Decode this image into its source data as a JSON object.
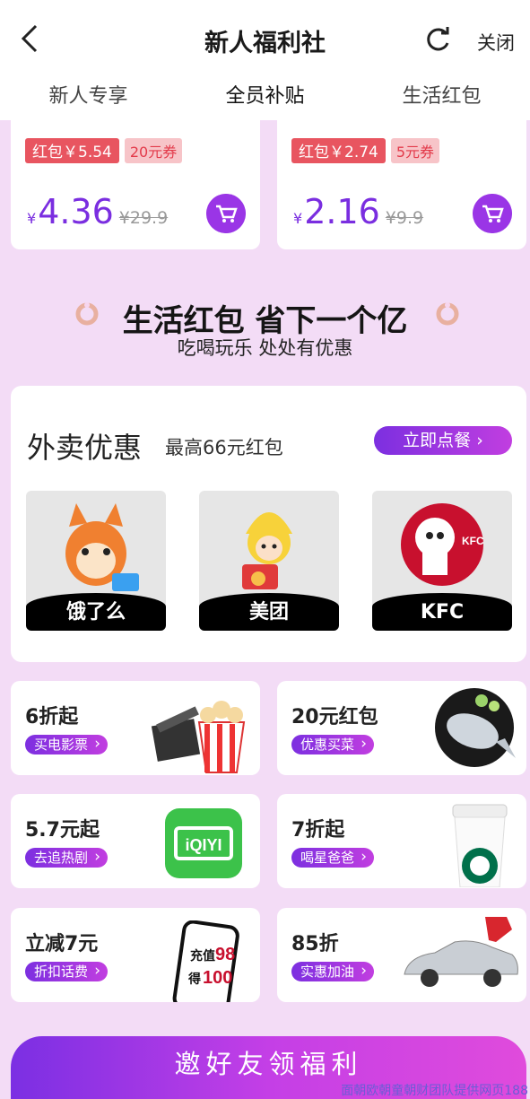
{
  "header": {
    "title": "新人福利社",
    "close_label": "关闭",
    "icons": [
      "back-arrow-icon",
      "refresh-icon"
    ]
  },
  "tabs": [
    {
      "label": "新人专享",
      "active": false
    },
    {
      "label": "全员补贴",
      "active": true
    },
    {
      "label": "生活红包",
      "active": false
    }
  ],
  "products": [
    {
      "redpack": "红包￥5.54",
      "coupon": "20元券",
      "yen": "¥",
      "price": "4.36",
      "old_price": "¥29.9"
    },
    {
      "redpack": "红包￥2.74",
      "coupon": "5元券",
      "yen": "¥",
      "price": "2.16",
      "old_price": "¥9.9"
    }
  ],
  "banner": {
    "title": "生活红包 省下一个亿",
    "subtitle": "吃喝玩乐 处处有优惠"
  },
  "waimai": {
    "title": "外卖优惠",
    "subtitle": "最高66元红包",
    "button": "立即点餐 ›",
    "brands": [
      {
        "label": "饿了么",
        "icon": "eleme-mascot"
      },
      {
        "label": "美团",
        "icon": "meituan-mascot"
      },
      {
        "label": "KFC",
        "icon": "kfc-logo"
      }
    ],
    "brand_logo_text": "KFC"
  },
  "grid": [
    {
      "title": "6折起",
      "button": "买电影票",
      "icon": "movie-popcorn-icon"
    },
    {
      "title": "20元红包",
      "button": "优惠买菜",
      "icon": "fish-plate-icon"
    },
    {
      "title": "5.7元起",
      "button": "去追热剧",
      "icon": "iqiyi-logo"
    },
    {
      "title": "7折起",
      "button": "喝星爸爸",
      "icon": "starbucks-cup-icon"
    },
    {
      "title": "立减7元",
      "button": "折扣话费",
      "icon": "phone-recharge-icon"
    },
    {
      "title": "85折",
      "button": "实惠加油",
      "icon": "car-fuel-icon"
    }
  ],
  "iqiyi_text": "iQIYI",
  "phone_text": {
    "line1": "充值",
    "num1": "98",
    "line2": "得",
    "num2": "100"
  },
  "invite_button": "邀好友领福利",
  "watermark": "面朝欧朝童朝财团队提供网页188",
  "colors": {
    "accent": "#7a2ee0",
    "red": "#e85560",
    "bg": "#f3dcf6"
  }
}
